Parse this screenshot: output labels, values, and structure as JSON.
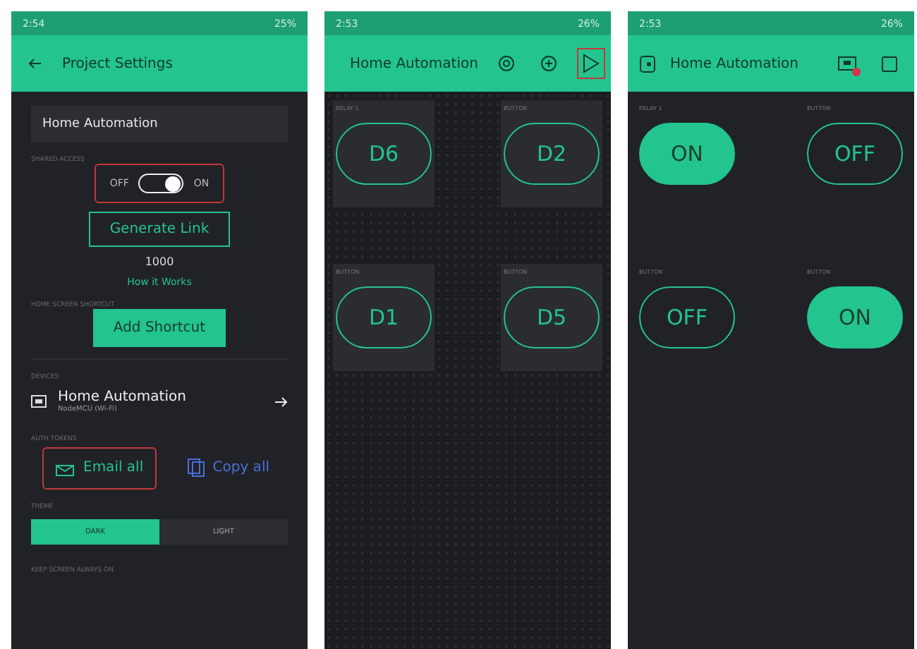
{
  "screens": [
    {
      "kind": "settings",
      "status_bar": {
        "time": "2:54",
        "battery": "25%"
      },
      "header": {
        "title": "Project Settings"
      },
      "project_name": "Home Automation",
      "shared_access": {
        "label": "SHARED ACCESS",
        "on": true,
        "off_label": "OFF",
        "on_label": "ON",
        "highlighted": true
      },
      "generate_link": "Generate Link",
      "access_count": "1000",
      "how_it_works": "How it Works",
      "shortcut": {
        "label": "HOME SCREEN SHORTCUT",
        "button": "Add Shortcut"
      },
      "devices": {
        "label": "DEVICES",
        "items": [
          {
            "name": "Home Automation",
            "subtitle": "NodeMCU (Wi-Fi)"
          }
        ]
      },
      "auth_tokens": {
        "label": "AUTH TOKENS",
        "actions": [
          {
            "kind": "email",
            "label": "Email all",
            "highlighted": true
          },
          {
            "kind": "copy",
            "label": "Copy all",
            "highlighted": false
          }
        ]
      },
      "theme": {
        "label": "THEME",
        "options": [
          {
            "label": "DARK",
            "selected": true
          },
          {
            "label": "LIGHT",
            "selected": false
          }
        ]
      },
      "keep_screen": {
        "label": "KEEP SCREEN ALWAYS ON"
      }
    },
    {
      "kind": "editor",
      "status_bar": {
        "time": "2:53",
        "battery": "26%"
      },
      "header": {
        "title": "Home Automation",
        "play_highlighted": true
      },
      "widgets": [
        {
          "label": "RELAY 1",
          "pin": "D6"
        },
        {
          "label": "BUTTON",
          "pin": "D2"
        },
        {
          "label": "BUTTON",
          "pin": "D1"
        },
        {
          "label": "BUTTON",
          "pin": "D5"
        }
      ]
    },
    {
      "kind": "dashboard",
      "status_bar": {
        "time": "2:53",
        "battery": "26%"
      },
      "header": {
        "title": "Home Automation"
      },
      "widgets": [
        {
          "label": "RELAY 1",
          "state": "ON",
          "on": true
        },
        {
          "label": "BUTTON",
          "state": "OFF",
          "on": false
        },
        {
          "label": "BUTTON",
          "state": "OFF",
          "on": false
        },
        {
          "label": "BUTTON",
          "state": "ON",
          "on": true
        }
      ]
    }
  ]
}
